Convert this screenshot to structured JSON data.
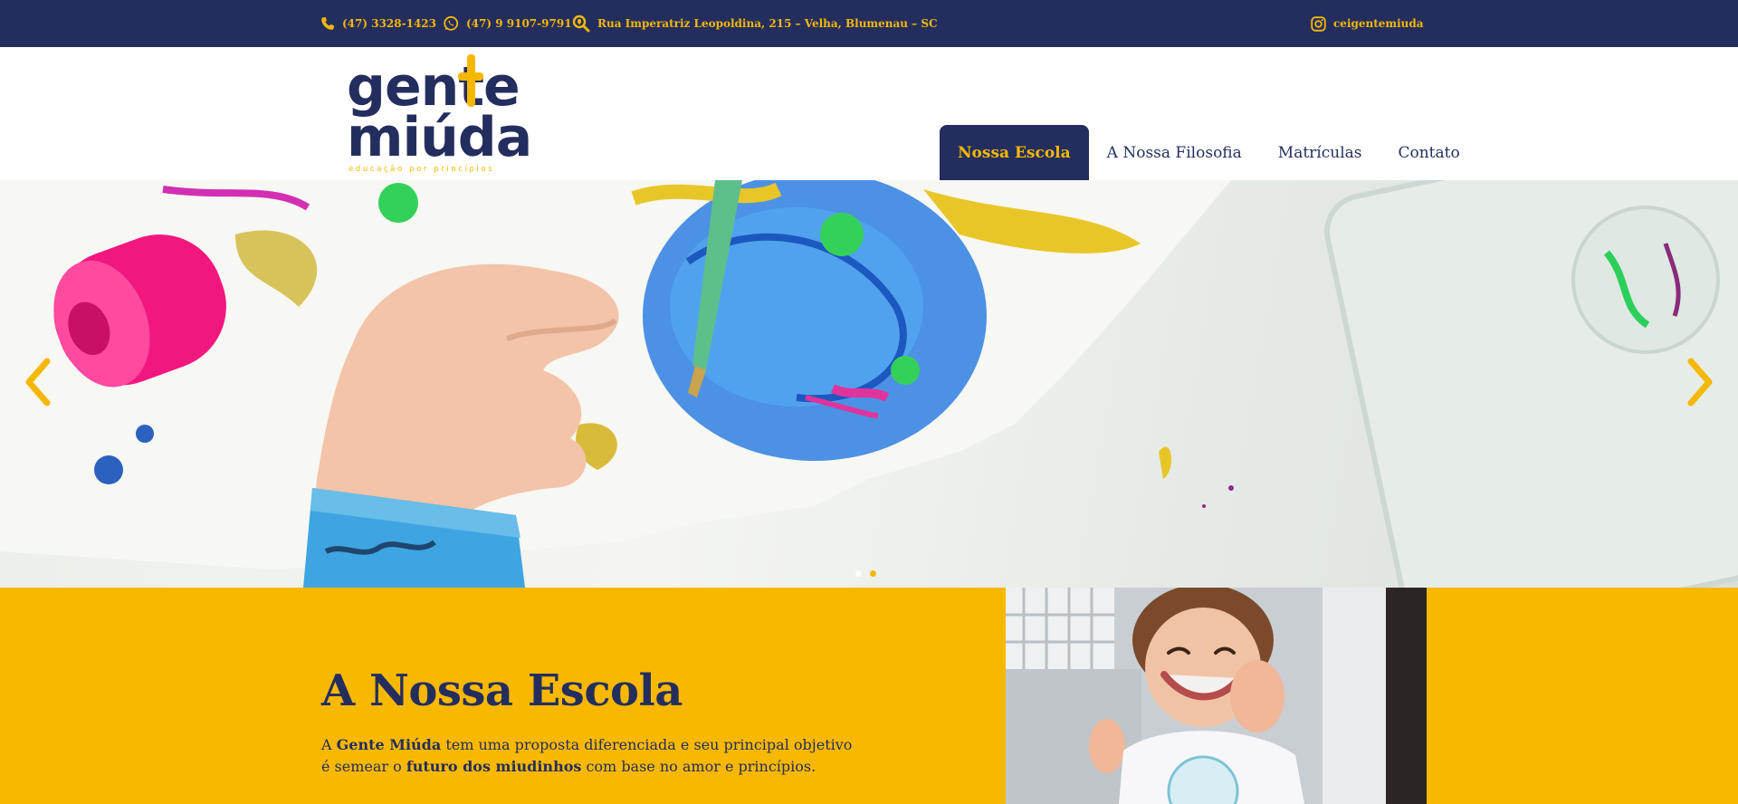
{
  "colors": {
    "navy": "#242e5e",
    "yellow": "#f9b800",
    "accent": "#f5b800"
  },
  "topbar": {
    "phone": {
      "icon": "phone-icon",
      "text": "(47) 3328-1423"
    },
    "whatsapp": {
      "icon": "whatsapp-icon",
      "text": "(47) 9 9107-9791"
    },
    "address": {
      "icon": "location-search-icon",
      "text": "Rua Imperatriz Leopoldina, 215 – Velha, Blumenau – SC"
    },
    "instagram": {
      "icon": "instagram-icon",
      "text": "ceigentemiuda"
    }
  },
  "logo": {
    "line1": "gente",
    "line2": "miúda",
    "tagline": "educação por princípios"
  },
  "nav": {
    "items": [
      {
        "label": "Nossa Escola",
        "active": true
      },
      {
        "label": "A Nossa Filosofia",
        "active": false
      },
      {
        "label": "Matrículas",
        "active": false
      },
      {
        "label": "Contato",
        "active": false
      }
    ]
  },
  "slider": {
    "slides": 2,
    "active_slide": 2,
    "prev_icon": "chevron-left-icon",
    "next_icon": "chevron-right-icon"
  },
  "intro": {
    "title": "A Nossa Escola",
    "text": {
      "p1": "A ",
      "b1": "Gente Miúda",
      "p2": " tem uma proposta diferenciada e seu principal objetivo é semear o ",
      "b2": "futuro dos miudinhos",
      "p3": " com base no amor e princípios."
    }
  }
}
